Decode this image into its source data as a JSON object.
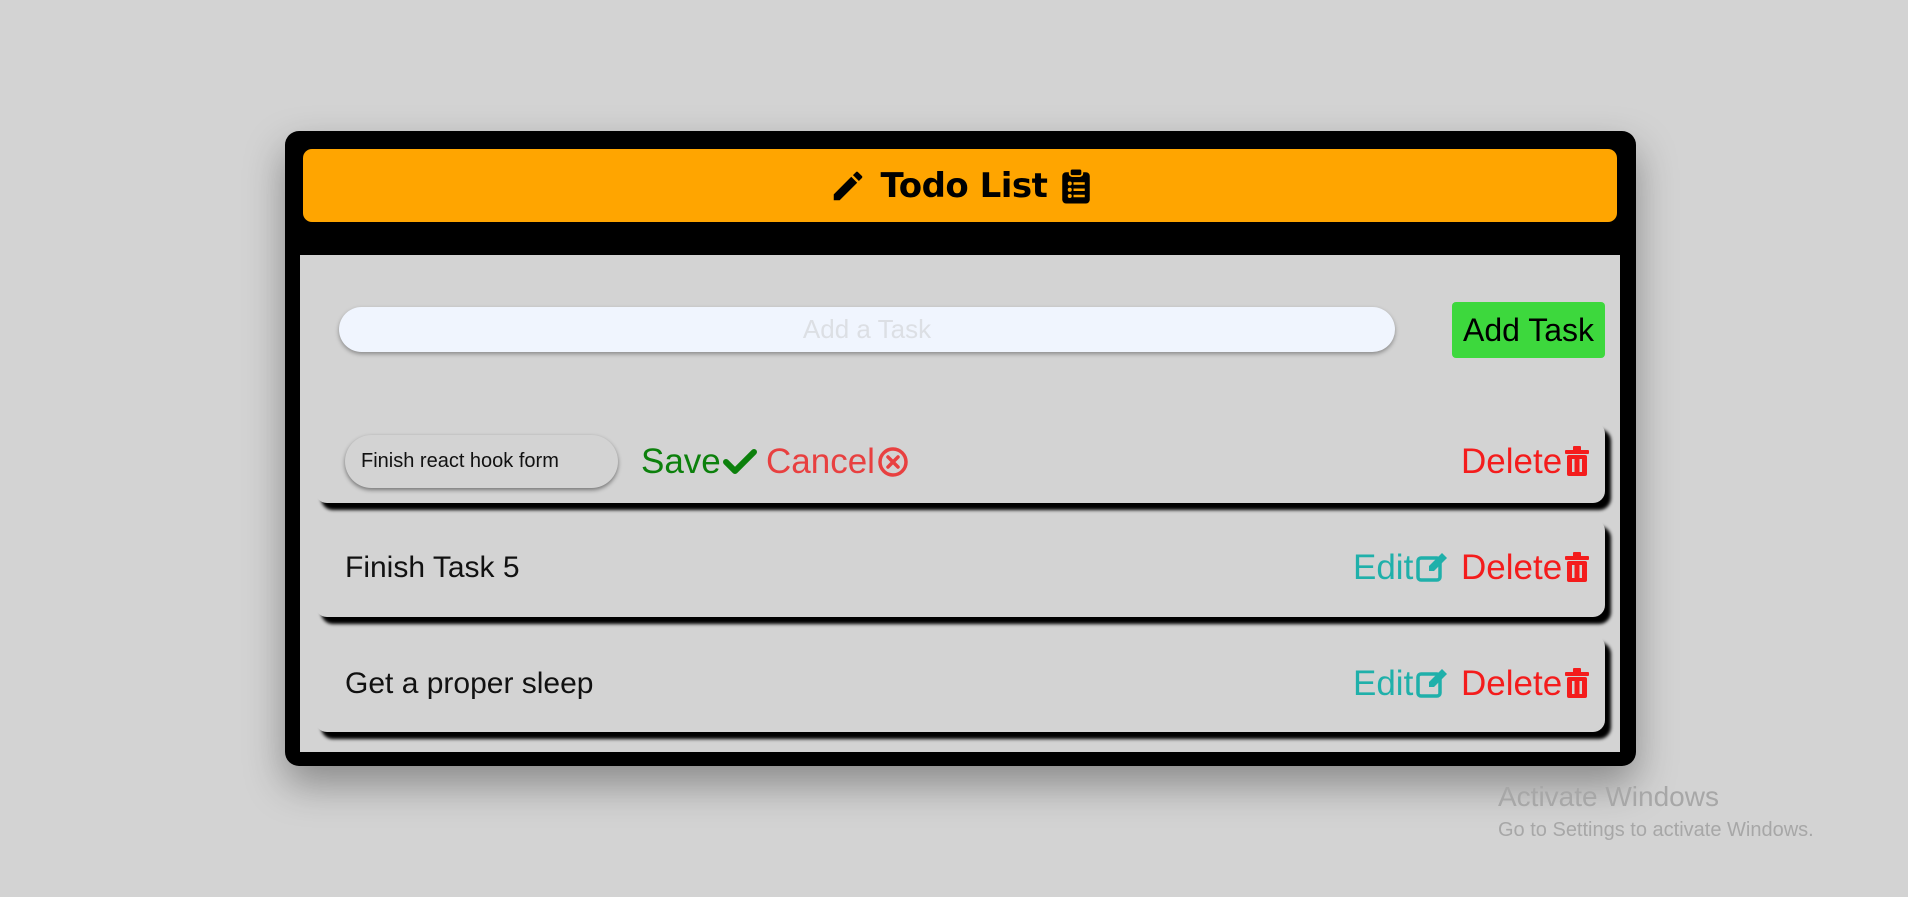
{
  "header": {
    "title": "Todo List"
  },
  "add_task": {
    "placeholder": "Add a Task",
    "button_label": "Add Task"
  },
  "tasks": [
    {
      "text": "Finish react hook form",
      "editing": true,
      "save_label": "Save",
      "cancel_label": "Cancel",
      "delete_label": "Delete"
    },
    {
      "text": "Finish Task 5",
      "editing": false,
      "edit_label": "Edit",
      "delete_label": "Delete"
    },
    {
      "text": "Get a proper sleep",
      "editing": false,
      "edit_label": "Edit",
      "delete_label": "Delete"
    }
  ],
  "watermark": {
    "line1": "Activate Windows",
    "line2": "Go to Settings to activate Windows."
  },
  "colors": {
    "page_background": "#d3d3d3",
    "header_background": "#ffa500",
    "add_button": "#3dd83d",
    "save": "#0c800c",
    "cancel": "#e84040",
    "edit": "#1fb0aa",
    "delete": "#f41c1c"
  },
  "icons": {
    "header_left": "pencil-icon",
    "header_right": "clipboard-list-icon",
    "save": "check-icon",
    "cancel": "circle-x-icon",
    "edit": "edit-square-icon",
    "delete": "trash-icon"
  }
}
